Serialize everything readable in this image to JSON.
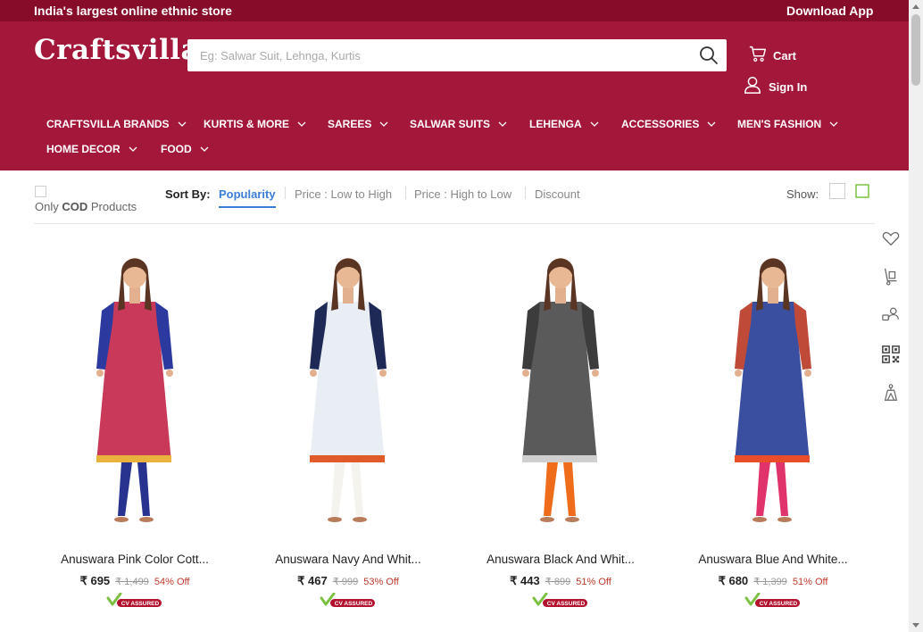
{
  "topbar": {
    "tagline": "India's largest online ethnic store",
    "download_app": "Download App"
  },
  "header": {
    "logo": "Craftsvilla",
    "search": {
      "placeholder": "Eg: Salwar Suit, Lehnga, Kurtis",
      "value": ""
    },
    "cart_label": "Cart",
    "signin_label": "Sign In"
  },
  "nav": [
    "CRAFTSVILLA BRANDS",
    "KURTIS & MORE",
    "SAREES",
    "SALWAR SUITS",
    "LEHENGA",
    "ACCESSORIES",
    "MEN'S FASHION",
    "HOME DECOR",
    "FOOD"
  ],
  "filters": {
    "cod_prefix": "Only",
    "cod_bold": "COD",
    "cod_suffix": "Products",
    "sort_by_label": "Sort By:",
    "sort_options": [
      "Popularity",
      "Price : Low to High",
      "Price : High to Low",
      "Discount"
    ],
    "sort_selected": "Popularity",
    "show_label": "Show:"
  },
  "products": [
    {
      "name": "Anuswara Pink Color Cott...",
      "price": "₹ 695",
      "mrp": "₹ 1,499",
      "discount": "54% Off",
      "badge": "CV ASSURED",
      "colors": {
        "top": "#c93a5a",
        "sleeve": "#2c3aa0",
        "pants": "#27338f",
        "trim": "#e8b23c"
      }
    },
    {
      "name": "Anuswara Navy And Whit...",
      "price": "₹ 467",
      "mrp": "₹ 999",
      "discount": "53% Off",
      "badge": "CV ASSURED",
      "colors": {
        "top": "#e9eef5",
        "sleeve": "#1e2a55",
        "pants": "#f5f3ee",
        "trim": "#e05a2a"
      }
    },
    {
      "name": "Anuswara Black And Whit...",
      "price": "₹ 443",
      "mrp": "₹ 899",
      "discount": "51% Off",
      "badge": "CV ASSURED",
      "colors": {
        "top": "#5a5a5a",
        "sleeve": "#3c3c3c",
        "pants": "#ef6c1a",
        "trim": "#cfcfcf"
      }
    },
    {
      "name": "Anuswara Blue And White...",
      "price": "₹ 680",
      "mrp": "₹ 1,399",
      "discount": "51% Off",
      "badge": "CV ASSURED",
      "colors": {
        "top": "#3b4fa0",
        "sleeve": "#c04a38",
        "pants": "#e0336c",
        "trim": "#e94d2a"
      }
    }
  ],
  "colors": {
    "topbar": "#870c2a",
    "header": "#a3173b",
    "accent": "#3a7dd6",
    "discount": "#c0392b"
  },
  "tools": [
    "wishlist-heart-icon",
    "delivery-trolley-icon",
    "chat-support-icon",
    "qr-code-icon",
    "hanger-icon"
  ]
}
